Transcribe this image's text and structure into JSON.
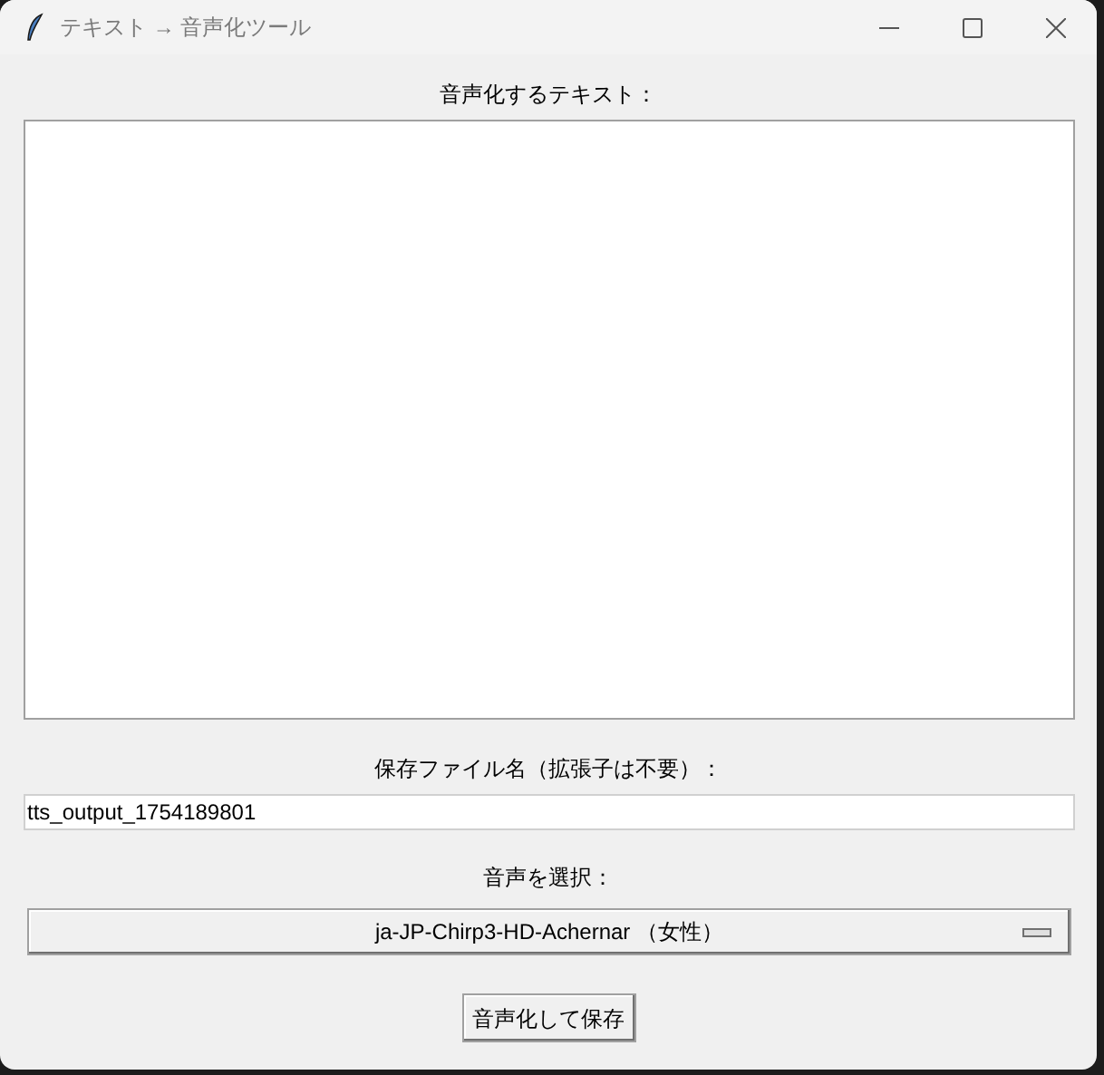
{
  "window": {
    "title": "テキスト → 音声化ツール"
  },
  "text_label": "音声化するテキスト：",
  "filename_label": "保存ファイル名（拡張子は不要）：",
  "filename_field": {
    "value": "tts_output_1754189801"
  },
  "voice_label": "音声を選択：",
  "voice_dropdown": {
    "value": "ja-JP-Chirp3-HD-Achernar （女性）"
  },
  "save_button": "音声化して保存"
}
